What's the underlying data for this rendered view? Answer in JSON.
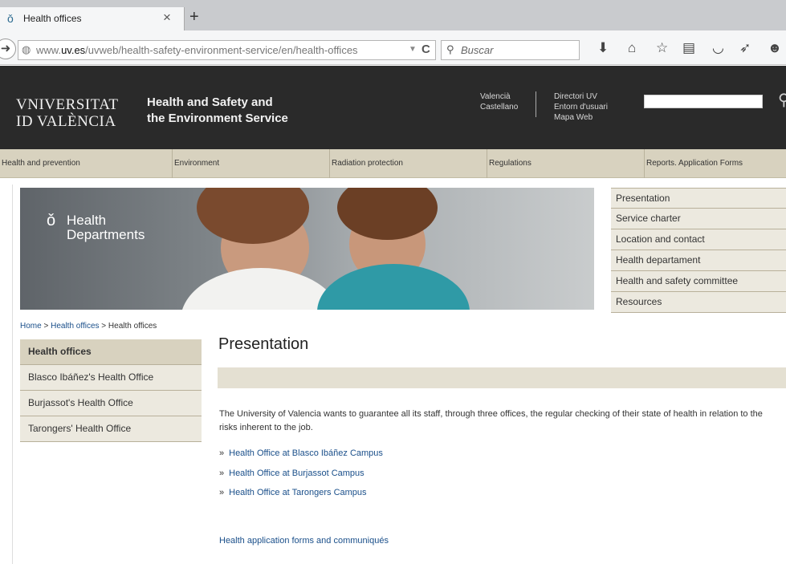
{
  "browser": {
    "tab_title": "Health offices",
    "tab_close": "×",
    "new_tab": "+",
    "url_prefix": "www.",
    "url_domain": "uv.es",
    "url_path": "/uvweb/health-safety-environment-service/en/health-offices",
    "search_placeholder": "Buscar"
  },
  "header": {
    "logo_line1": "VNIVERSITAT",
    "logo_line2": "ID VALÈNCIA",
    "service_line1": "Health and Safety and",
    "service_line2": "the Environment Service",
    "lang_1": "Valencià",
    "lang_2": "Castellano",
    "link_1": "Directori UV",
    "link_2": "Entorn d'usuari",
    "link_3": "Mapa Web"
  },
  "nav": {
    "items": [
      "Health and prevention",
      "Environment",
      "Radiation protection",
      "Regulations",
      "Reports. Application Forms"
    ]
  },
  "banner": {
    "line1": "Health",
    "line2": "Departments"
  },
  "right_menu": {
    "items": [
      "Presentation",
      "Service charter",
      "Location and contact",
      "Health departament",
      "Health and safety committee",
      "Resources"
    ]
  },
  "breadcrumb": {
    "home": "Home",
    "sep": ">",
    "level1": "Health offices",
    "current": "Health offices"
  },
  "left_menu": {
    "items": [
      "Health offices",
      "Blasco Ibáñez's Health Office",
      "Burjassot's Health Office",
      "Tarongers' Health Office"
    ]
  },
  "content": {
    "title": "Presentation",
    "paragraph": "The University of Valencia wants to guarantee all its staff, through three offices, the regular checking of their state of health in relation to the risks inherent to the job.",
    "links": [
      "Health Office at Blasco Ibáñez Campus",
      "Health Office at Burjassot Campus",
      "Health Office at Tarongers Campus"
    ],
    "forms_link": "Health application forms and communiqués"
  },
  "icons": {
    "favicon": "health-favicon-icon",
    "back": "back-arrow-icon",
    "globe": "globe-icon",
    "reload": "reload-icon",
    "search": "search-icon",
    "download": "download-icon",
    "home": "home-icon",
    "bookmark": "star-icon",
    "reading": "clipboard-icon",
    "pocket": "pocket-icon",
    "send": "send-icon",
    "menu": "chat-icon"
  }
}
